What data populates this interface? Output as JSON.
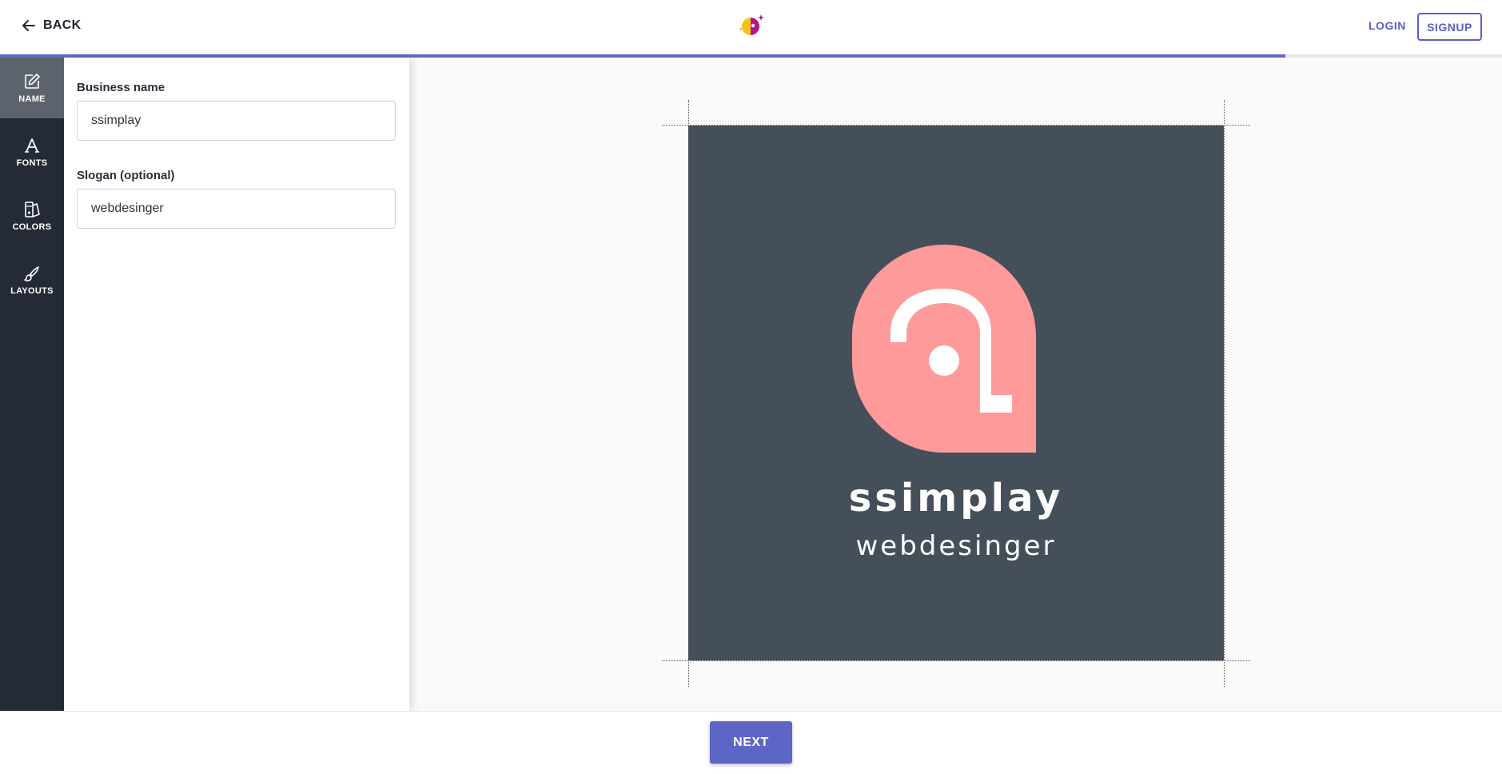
{
  "header": {
    "back_label": "BACK",
    "login_label": "LOGIN",
    "signup_label": "SIGNUP",
    "progress_percent": 85.6
  },
  "sidebar": {
    "items": [
      {
        "label": "NAME",
        "icon": "edit-icon",
        "active": true
      },
      {
        "label": "FONTS",
        "icon": "font-icon",
        "active": false
      },
      {
        "label": "COLORS",
        "icon": "palette-icon",
        "active": false
      },
      {
        "label": "LAYOUTS",
        "icon": "brush-icon",
        "active": false
      }
    ]
  },
  "form": {
    "business_name_label": "Business name",
    "business_name_value": "ssimplay",
    "slogan_label": "Slogan (optional)",
    "slogan_value": "webdesinger"
  },
  "preview": {
    "business_name": "ssimplay",
    "slogan": "webdesinger",
    "colors": {
      "background": "#454f5a",
      "mark": "#ff9a9a",
      "text": "#ffffff"
    }
  },
  "footer": {
    "next_label": "NEXT"
  },
  "colors": {
    "accent": "#5d66c7",
    "sidebar_bg": "#252b36"
  }
}
